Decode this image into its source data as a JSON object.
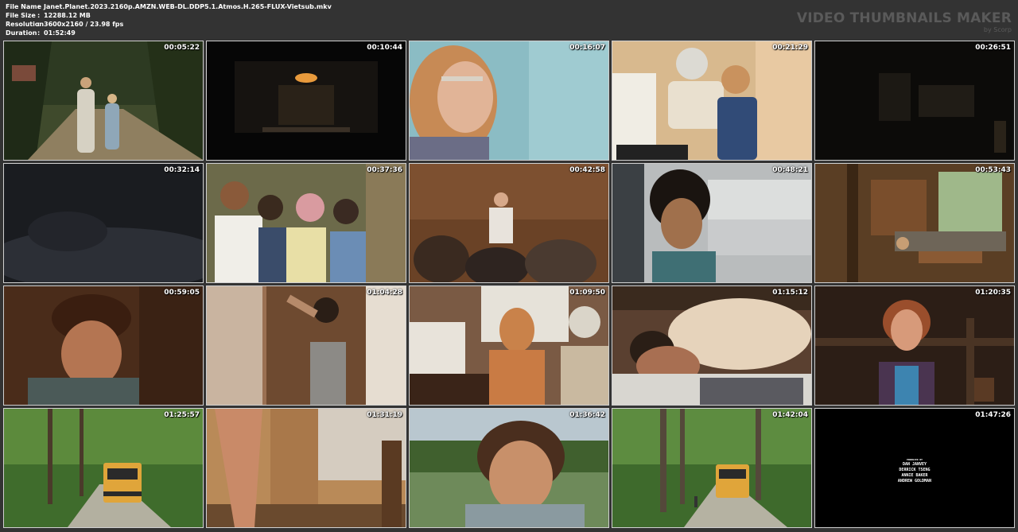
{
  "info": {
    "file_name_label": "File Name",
    "file_name": "Janet.Planet.2023.2160p.AMZN.WEB-DL.DDP5.1.Atmos.H.265-FLUX-Vietsub.mkv",
    "file_size_label": "File Size",
    "file_size": "12288.12 MB",
    "resolution_label": "Resolution",
    "resolution": "3600x2160 / 23.98 fps",
    "duration_label": "Duration",
    "duration": "01:52:49",
    "separator": ":"
  },
  "brand": {
    "title": "VIDEO THUMBNAILS MAKER",
    "subtitle": "by Scorp"
  },
  "thumbnails": [
    {
      "time": "00:05:22"
    },
    {
      "time": "00:10:44"
    },
    {
      "time": "00:16:07"
    },
    {
      "time": "00:21:29"
    },
    {
      "time": "00:26:51"
    },
    {
      "time": "00:32:14"
    },
    {
      "time": "00:37:36"
    },
    {
      "time": "00:42:58"
    },
    {
      "time": "00:48:21"
    },
    {
      "time": "00:53:43"
    },
    {
      "time": "00:59:05"
    },
    {
      "time": "01:04:28"
    },
    {
      "time": "01:09:50"
    },
    {
      "time": "01:15:12"
    },
    {
      "time": "01:20:35"
    },
    {
      "time": "01:25:57"
    },
    {
      "time": "01:31:19"
    },
    {
      "time": "01:36:42"
    },
    {
      "time": "01:42:04"
    },
    {
      "time": "01:47:26"
    }
  ],
  "credits": {
    "produced_by": "PRODUCED BY",
    "names": [
      "DAN JANVEY",
      "DERRICK TSENG",
      "ANNIE BAKER",
      "ANDREW GOLDMAN"
    ]
  }
}
